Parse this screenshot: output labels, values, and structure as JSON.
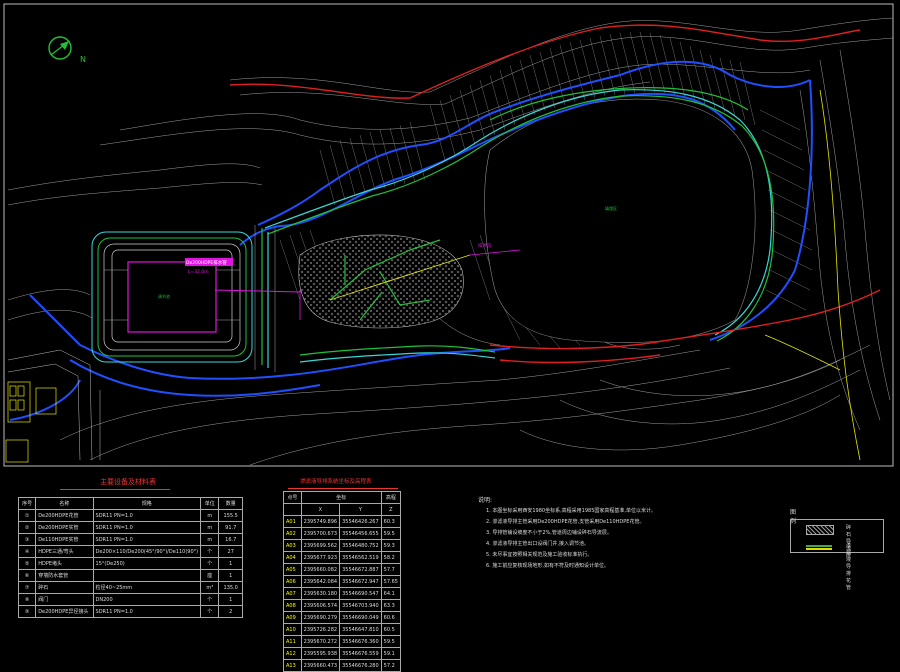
{
  "north_label": "N",
  "labels": {
    "pond_label": "调节池",
    "pipe_callout_1": "De200HDPE排水管",
    "pipe_callout_2": "L=32.0m",
    "area_label": "填埋区",
    "slope_callout": "排洪沟"
  },
  "material_table": {
    "title": "主要设备及材料表",
    "headers": [
      "序号",
      "名称",
      "规格",
      "单位",
      "数量"
    ],
    "rows": [
      [
        "①",
        "De200HDPE花管",
        "SDR11 PN=1.0",
        "m",
        "155.5"
      ],
      [
        "②",
        "De200HDPE实管",
        "SDR11 PN=1.0",
        "m",
        "91.7"
      ],
      [
        "③",
        "De110HDPE实管",
        "SDR11 PN=1.0",
        "m",
        "16.7"
      ],
      [
        "④",
        "HDPE三通/弯头",
        "De200×110/De200(45°/90°)/De110(90°)",
        "个",
        "27"
      ],
      [
        "⑤",
        "HDPE堵头",
        "15°(De250)",
        "个",
        "1"
      ],
      [
        "⑥",
        "穿墙防水套管",
        "",
        "座",
        "1"
      ],
      [
        "⑦",
        "碎石",
        "粒径40~25mm",
        "m³",
        "135.0"
      ],
      [
        "⑧",
        "阀门",
        "DN200",
        "个",
        "1"
      ],
      [
        "⑨",
        "De200HDPE异径接头",
        "SDR11 PN=1.0",
        "个",
        "2"
      ]
    ]
  },
  "coord_table": {
    "title": "渗滤液导排系统坐标及高程表",
    "headers": [
      "点号",
      "坐标",
      "",
      "高程"
    ],
    "subheaders": [
      "",
      "X",
      "Y",
      "Z"
    ],
    "rows": [
      [
        "A01",
        "2395749.896",
        "35546426.267",
        "60.3"
      ],
      [
        "A02",
        "2395700.673",
        "35546456.655",
        "59.5"
      ],
      [
        "A03",
        "2395699.562",
        "35546480.752",
        "59.3"
      ],
      [
        "A04",
        "2395677.923",
        "35546562.519",
        "58.2"
      ],
      [
        "A05",
        "2395660.082",
        "35546672.887",
        "57.7"
      ],
      [
        "A06",
        "2395642.084",
        "35546672.947",
        "57.65"
      ],
      [
        "A07",
        "2395630.180",
        "35546690.547",
        "64.1"
      ],
      [
        "A08",
        "2395606.574",
        "35546703.940",
        "63.3"
      ],
      [
        "A09",
        "2395690.279",
        "35546690.049",
        "60.6"
      ],
      [
        "A10",
        "2395726.282",
        "35546647.810",
        "60.5"
      ],
      [
        "A11",
        "2395670.272",
        "35546676.360",
        "59.5"
      ],
      [
        "A12",
        "2395595.938",
        "35546676.559",
        "59.1"
      ],
      [
        "A13",
        "2395660.473",
        "35546676.280",
        "57.2"
      ]
    ]
  },
  "notes": {
    "title": "说明:",
    "items": [
      "1. 本图坐标采用西安1980坐标系,高程采用1985国家高程基准,单位以米计。",
      "2. 渗滤液导排主管采用De200HDPE花管,支管采用De110HDPE花管。",
      "3. 导排管铺设坡度不小于2%,管道周边铺设碎石导流层。",
      "4. 渗滤液导排主管出口设阀门井,接入调节池。",
      "5. 未尽事宜按照相关规范及施工验收标准执行。",
      "6. 施工前应复核现场地形,如有不符及时通知设计单位。"
    ]
  },
  "legend": {
    "title": "图例",
    "items": [
      "碎石导流层",
      "渗滤液导排花管"
    ]
  },
  "colors": {
    "contour": "#c8c8c8",
    "road_blue": "#1f4fff",
    "green": "#22c03a",
    "magenta": "#e014e0",
    "red": "#e02020",
    "yellow": "#e6e600",
    "cyan": "#3ad6d6"
  }
}
